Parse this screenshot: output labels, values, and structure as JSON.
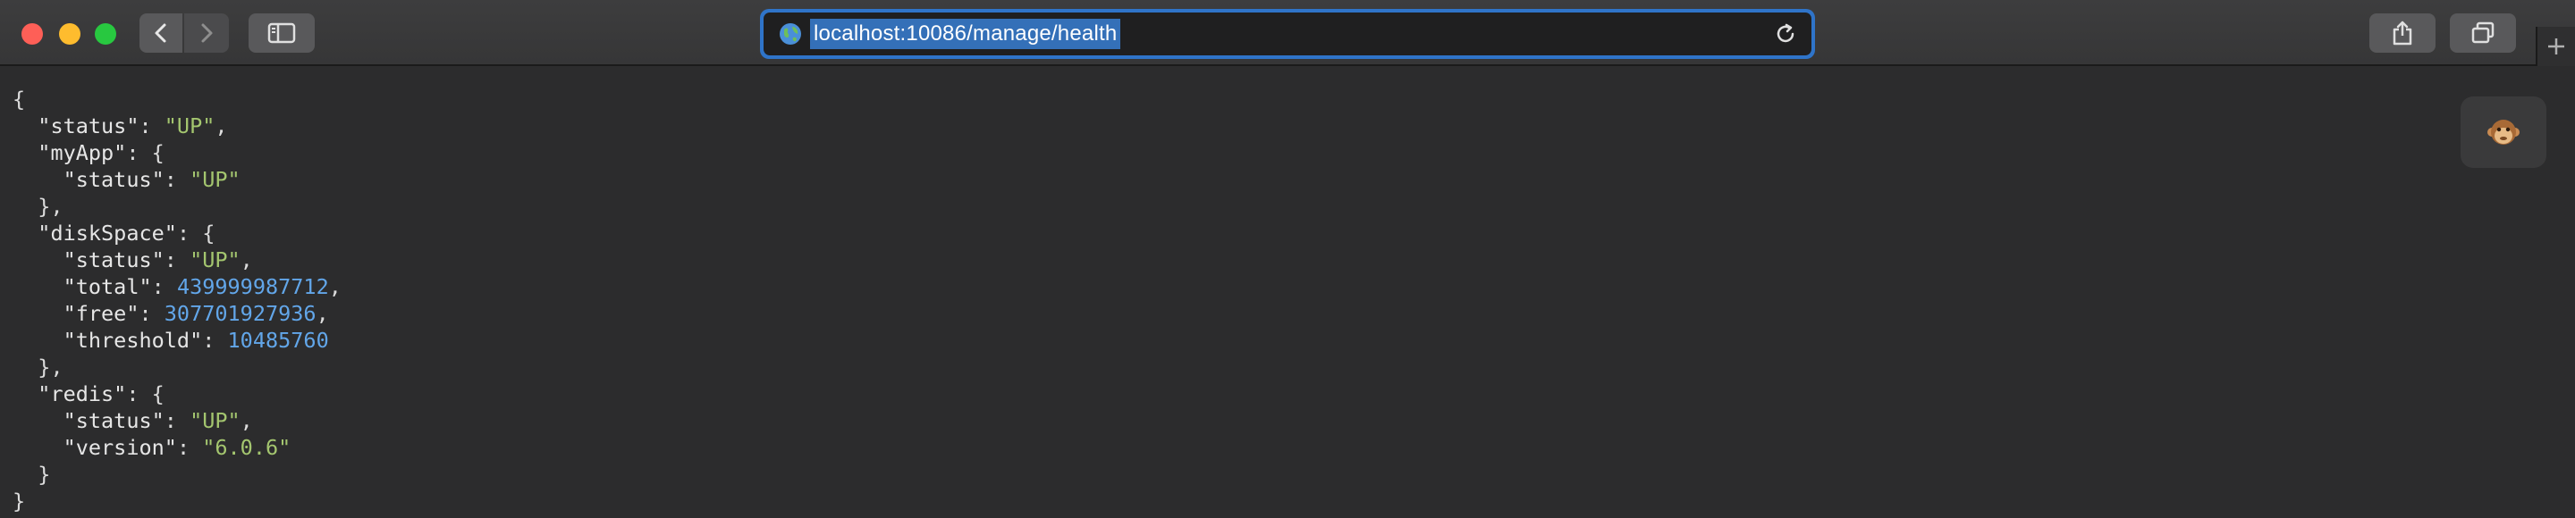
{
  "browser": {
    "url": "localhost:10086/manage/health",
    "icons": {
      "back": "chevron-left-icon",
      "forward": "chevron-right-icon",
      "sidebar": "sidebar-icon",
      "site": "globe-icon",
      "reload": "reload-icon",
      "share": "share-icon",
      "tabs": "tab-overview-icon",
      "new_tab": "plus-icon",
      "extension": "monkey-icon"
    }
  },
  "json": {
    "open": "{",
    "close": "}",
    "root_status_key": "\"status\"",
    "root_status_val": "\"UP\"",
    "myApp_key": "\"myApp\"",
    "myApp_status_key": "\"status\"",
    "myApp_status_val": "\"UP\"",
    "disk_key": "\"diskSpace\"",
    "disk_status_key": "\"status\"",
    "disk_status_val": "\"UP\"",
    "disk_total_key": "\"total\"",
    "disk_total_val": "439999987712",
    "disk_free_key": "\"free\"",
    "disk_free_val": "307701927936",
    "disk_threshold_key": "\"threshold\"",
    "disk_threshold_val": "10485760",
    "redis_key": "\"redis\"",
    "redis_status_key": "\"status\"",
    "redis_status_val": "\"UP\"",
    "redis_version_key": "\"version\"",
    "redis_version_val": "\"6.0.6\""
  },
  "colors": {
    "string": "#a4c66f",
    "number": "#62a6e9",
    "address_focus": "#2f74c9"
  }
}
